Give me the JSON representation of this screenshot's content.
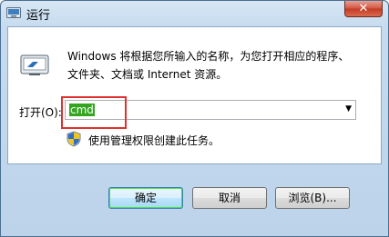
{
  "window": {
    "title": "运行"
  },
  "titlebar": {
    "close_glyph": "✕"
  },
  "description": {
    "line1": "Windows 将根据您所输入的名称，为您打开相应的程序、",
    "line2": "文件夹、文档或 Internet 资源。"
  },
  "open_field": {
    "label": "打开(O):",
    "value": "cmd",
    "dropdown_glyph": "▼"
  },
  "admin_note": "使用管理权限创建此任务。",
  "buttons": {
    "ok": "确定",
    "cancel": "取消",
    "browse": "浏览(B)..."
  },
  "colors": {
    "selection": "#33a51e",
    "highlight_box": "#e03030",
    "close_button": "#c33b24"
  }
}
